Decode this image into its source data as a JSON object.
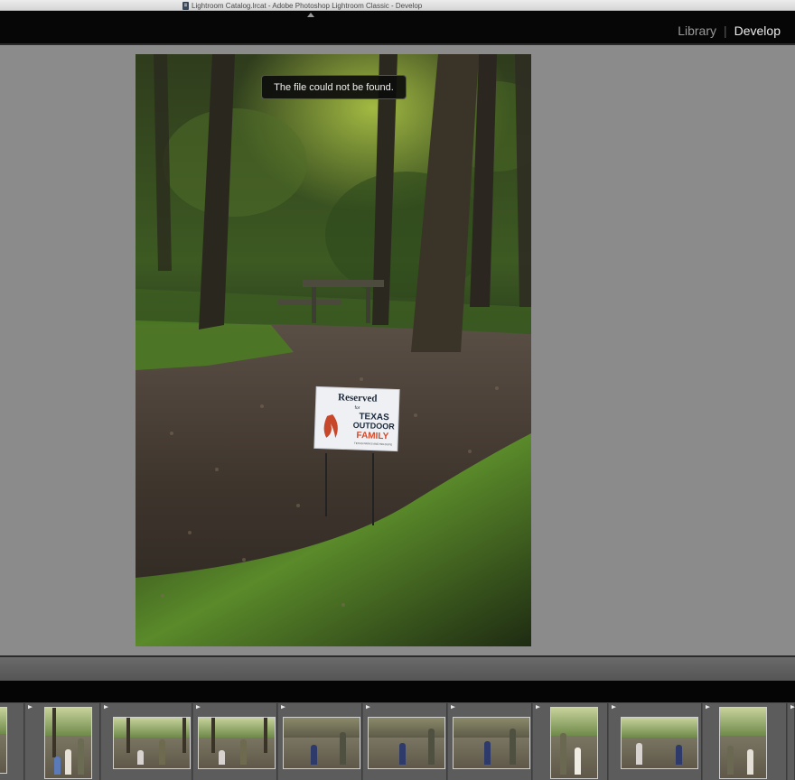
{
  "window": {
    "title": "Lightroom Catalog.lrcat - Adobe Photoshop Lightroom Classic - Develop"
  },
  "header": {
    "modules": [
      {
        "label": "Library",
        "active": false
      },
      {
        "label": "Develop",
        "active": true
      }
    ]
  },
  "workspace": {
    "error_message": "The file could not be found.",
    "photo": {
      "sign_line1": "Reserved",
      "sign_line2": "for",
      "sign_line3": "TEXAS",
      "sign_line4": "OUTDOOR",
      "sign_line5": "FAMILY",
      "sign_line6": "TEXAS PARKS AND WILDLIFE"
    }
  },
  "filmstrip": {
    "thumbnails": [
      {
        "flagged": true,
        "orientation": "portrait",
        "selected": false
      },
      {
        "flagged": true,
        "orientation": "portrait",
        "selected": true
      },
      {
        "flagged": true,
        "orientation": "landscape",
        "selected": false
      },
      {
        "flagged": true,
        "orientation": "landscape",
        "selected": false
      },
      {
        "flagged": true,
        "orientation": "landscape",
        "selected": false
      },
      {
        "flagged": true,
        "orientation": "landscape",
        "selected": false
      },
      {
        "flagged": true,
        "orientation": "landscape",
        "selected": false
      },
      {
        "flagged": true,
        "orientation": "portrait",
        "selected": false
      },
      {
        "flagged": true,
        "orientation": "landscape",
        "selected": false
      },
      {
        "flagged": true,
        "orientation": "portrait",
        "selected": false
      },
      {
        "flagged": true,
        "orientation": "portrait",
        "selected": false
      }
    ]
  },
  "colors": {
    "workspace_bg": "#8b8b8b",
    "header_bg": "#060606",
    "module_active": "#ececec",
    "module_inactive": "#9a9a9a"
  }
}
